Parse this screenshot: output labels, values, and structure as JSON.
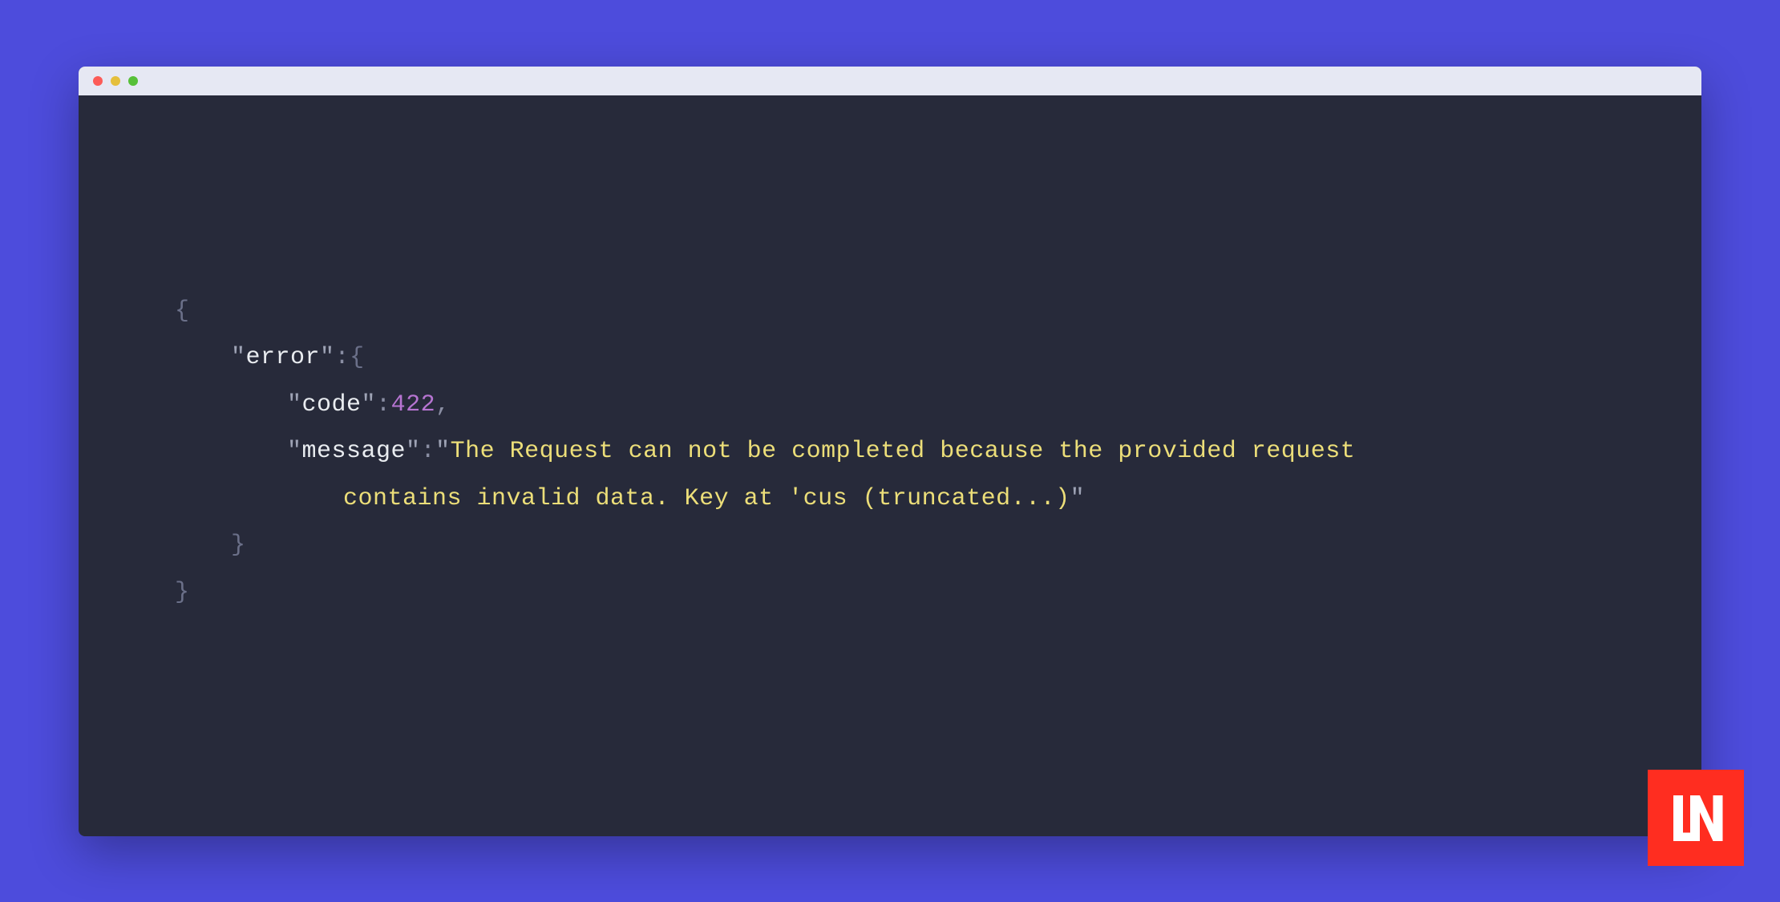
{
  "code": {
    "error_key": "error",
    "code_key": "code",
    "code_value": "422",
    "message_key": "message",
    "message_value_line1": "The Request can not be completed because the provided request",
    "message_value_line2": "contains invalid data. Key at 'cus (truncated...)"
  },
  "logo": {
    "name": "LN"
  }
}
